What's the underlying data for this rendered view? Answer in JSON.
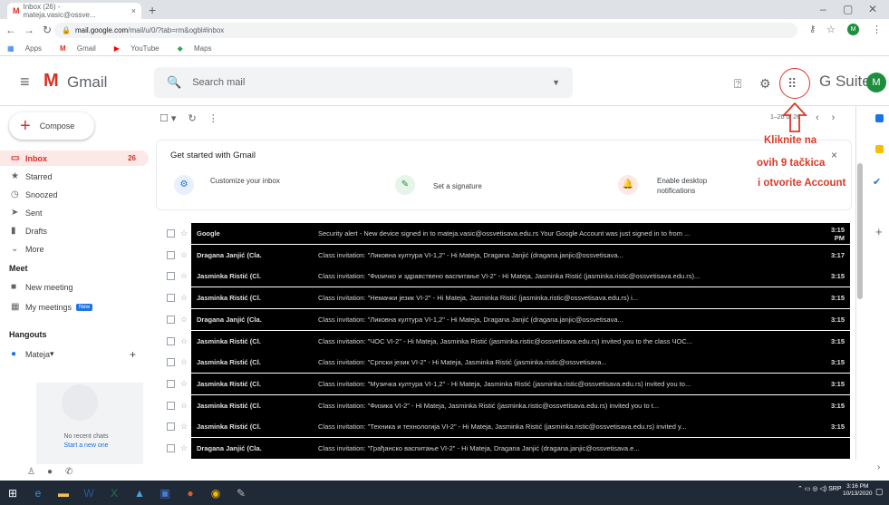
{
  "browser": {
    "tab_title": "Inbox (26) - mateja.vasic@ossve...",
    "tab_close": "×",
    "new_tab": "+",
    "url_host": "mail.google.com",
    "url_path": "/mail/u/0/?tab=rm&ogbl#inbox",
    "bookmarks": [
      "Apps",
      "Gmail",
      "YouTube",
      "Maps"
    ]
  },
  "header": {
    "product": "Gmail",
    "search_placeholder": "Search mail",
    "gsuite": "G Suite",
    "avatar": "M"
  },
  "sidebar": {
    "compose": "Compose",
    "items": [
      {
        "label": "Inbox",
        "count": "26"
      },
      {
        "label": "Starred"
      },
      {
        "label": "Snoozed"
      },
      {
        "label": "Sent"
      },
      {
        "label": "Drafts"
      },
      {
        "label": "More"
      }
    ],
    "meet_title": "Meet",
    "meet_items": [
      "New meeting",
      "My meetings"
    ],
    "meet_badge": "New",
    "hangouts_title": "Hangouts",
    "hangouts_user": "Mateja",
    "no_chats": "No recent chats",
    "start_chat": "Start a new one"
  },
  "toolbar": {
    "page": "1–26 of 26"
  },
  "card": {
    "title": "Get started with Gmail",
    "items": [
      "Customize your inbox",
      "Set a signature",
      "Enable desktop notifications"
    ]
  },
  "annotation": {
    "line1": "Kliknite na",
    "line2": "ovih 9 tačkica",
    "line3": "i otvorite Account"
  },
  "emails": [
    {
      "sender": "Google",
      "text": "Security alert - New device signed in to mateja.vasic@ossvetisava.edu.rs Your Google Account was just signed in to from ...",
      "date": "3:15 PM"
    },
    {
      "sender": "Dragana Janjić (Cla.",
      "text": "Class invitation: \"Ликовна култура VI-1,2\" - Hi Mateja, Dragana Janjić (dragana.janjic@ossvetisava...",
      "date": "3:17"
    },
    {
      "sender": "Jasminka Ristić (Cl.",
      "text": "Class invitation: \"Физичко и здравствено васпитање VI-2\" - Hi Mateja, Jasminka Ristić (jasminka.ristic@ossvetisava.edu.rs)...",
      "date": "3:15"
    },
    {
      "sender": "Jasminka Ristić (Cl.",
      "text": "Class invitation: \"Немачки језик VI-2\" - Hi Mateja, Jasminka Ristić (jasminka.ristic@ossvetisava.edu.rs) i...",
      "date": "3:15"
    },
    {
      "sender": "Dragana Janjić (Cla.",
      "text": "Class invitation: \"Ликовна култура VI-1,2\" - Hi Mateja, Dragana Janjić (dragana.janjic@ossvetisava...",
      "date": "3:15"
    },
    {
      "sender": "Jasminka Ristić (Cl.",
      "text": "Class invitation: \"ЧОС VI-2\" - Hi Mateja, Jasminka Ristić (jasminka.ristic@ossvetisava.edu.rs) invited you to the class ЧОС...",
      "date": "3:15"
    },
    {
      "sender": "Jasminka Ristić (Cl.",
      "text": "Class invitation: \"Српски језик VI-2\" - Hi Mateja, Jasminka Ristić (jasminka.ristic@ossvetisava...",
      "date": "3:15"
    },
    {
      "sender": "Jasminka Ristić (Cl.",
      "text": "Class invitation: \"Музичка култура VI-1,2\" - Hi Mateja, Jasminka Ristić (jasminka.ristic@ossvetisava.edu.rs) invited you to...",
      "date": "3:15"
    },
    {
      "sender": "Jasminka Ristić (Cl.",
      "text": "Class invitation: \"Физика VI-2\" - Hi Mateja, Jasminka Ristić (jasminka.ristic@ossvetisava.edu.rs) invited you to t...",
      "date": "3:15"
    },
    {
      "sender": "Jasminka Ristić (Cl.",
      "text": "Class invitation: \"Техника и технологија VI-2\" - Hi Mateja, Jasminka Ristić (jasminka.ristic@ossvetisava.edu.rs) invited y...",
      "date": "3:15"
    },
    {
      "sender": "Dragana Janjić (Cla.",
      "text": "Class invitation: \"Грађанско васпитање VI-2\" - Hi Mateja, Dragana Janjić (dragana.janjic@ossvetisava.e...",
      "date": ""
    }
  ],
  "taskbar": {
    "lang": "SRP",
    "time": "3:16 PM",
    "date": "10/13/2020"
  }
}
